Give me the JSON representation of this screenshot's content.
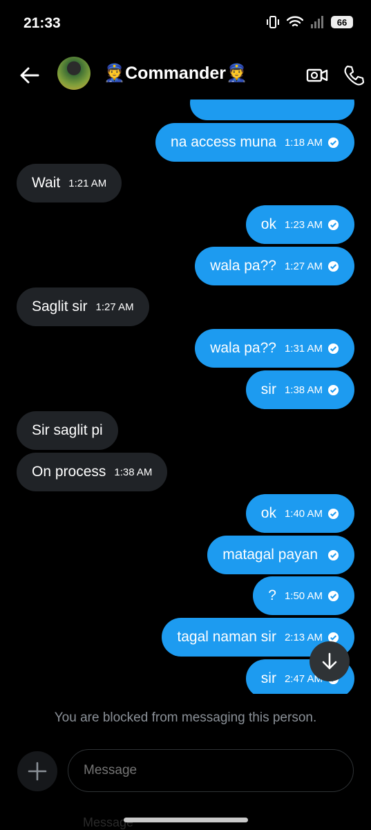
{
  "status_bar": {
    "time": "21:33",
    "battery": "66"
  },
  "header": {
    "title": "👮Commander👮"
  },
  "messages": [
    {
      "dir": "out",
      "text": "na access muna",
      "time": "1:18 AM",
      "read": true
    },
    {
      "dir": "in",
      "text": "Wait",
      "time": "1:21 AM"
    },
    {
      "dir": "out",
      "text": "ok",
      "time": "1:23 AM",
      "read": true
    },
    {
      "dir": "out",
      "text": "wala pa??",
      "time": "1:27 AM",
      "read": true
    },
    {
      "dir": "in",
      "text": "Saglit sir",
      "time": "1:27 AM"
    },
    {
      "dir": "out",
      "text": "wala pa??",
      "time": "1:31 AM",
      "read": true
    },
    {
      "dir": "out",
      "text": "sir",
      "time": "1:38 AM",
      "read": true
    },
    {
      "dir": "in",
      "text": "Sir saglit pi",
      "time": ""
    },
    {
      "dir": "in",
      "text": "On process",
      "time": "1:38 AM"
    },
    {
      "dir": "out",
      "text": "ok",
      "time": "1:40 AM",
      "read": true
    },
    {
      "dir": "out",
      "text": "matagal payan",
      "time": "",
      "read": true
    },
    {
      "dir": "out",
      "text": "?",
      "time": "1:50 AM",
      "read": true
    },
    {
      "dir": "out",
      "text": "tagal naman sir",
      "time": "2:13 AM",
      "read": true
    },
    {
      "dir": "out",
      "text": "sir",
      "time": "2:47 AM",
      "read": true
    }
  ],
  "blocked_notice": "You are blocked from messaging this person.",
  "composer": {
    "placeholder": "Message"
  },
  "ghost_text": "Message",
  "colors": {
    "outgoing": "#1d9bf0",
    "incoming": "#202327",
    "background": "#000000"
  },
  "icons": {
    "back": "arrow-left-icon",
    "video": "video-camera-icon",
    "call": "phone-icon",
    "scroll": "arrow-down-icon",
    "add": "plus-icon",
    "read": "check-circle-icon"
  }
}
